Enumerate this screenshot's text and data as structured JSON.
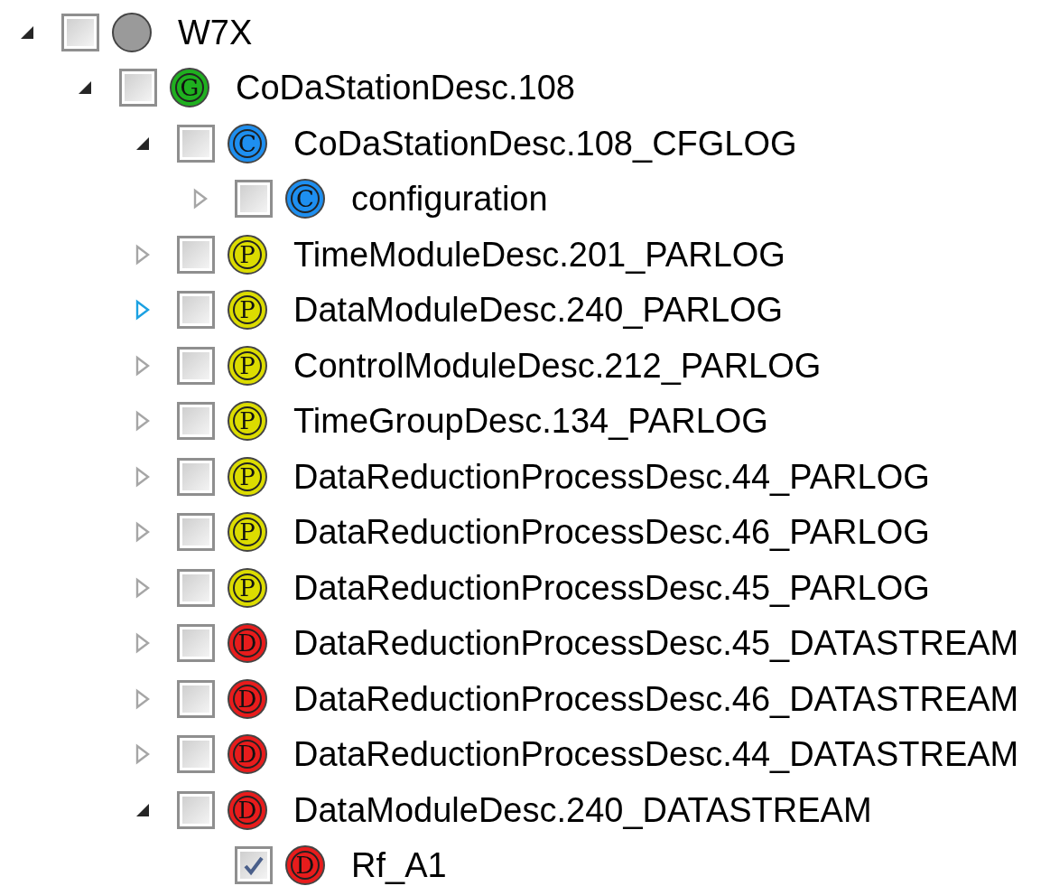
{
  "tree": [
    {
      "label": "W7X",
      "kind": "node",
      "expanded": true,
      "checked": false,
      "hovered": false,
      "color": "#9a9a9a",
      "children": [
        {
          "label": "CoDaStationDesc.108",
          "kind": "node",
          "expanded": true,
          "checked": false,
          "hovered": false,
          "badge": "G",
          "color": "#1fb01f",
          "children": [
            {
              "label": "CoDaStationDesc.108_CFGLOG",
              "kind": "node",
              "expanded": true,
              "checked": false,
              "hovered": false,
              "badge": "C",
              "color": "#1e8ff0",
              "children": [
                {
                  "label": "configuration",
                  "kind": "node",
                  "expanded": false,
                  "checked": false,
                  "hovered": false,
                  "badge": "C",
                  "color": "#1e8ff0"
                }
              ]
            },
            {
              "label": "TimeModuleDesc.201_PARLOG",
              "kind": "node",
              "expanded": false,
              "checked": false,
              "hovered": false,
              "badge": "P",
              "color": "#dcdc00"
            },
            {
              "label": "DataModuleDesc.240_PARLOG",
              "kind": "node",
              "expanded": false,
              "checked": false,
              "hovered": true,
              "badge": "P",
              "color": "#dcdc00"
            },
            {
              "label": "ControlModuleDesc.212_PARLOG",
              "kind": "node",
              "expanded": false,
              "checked": false,
              "hovered": false,
              "badge": "P",
              "color": "#dcdc00"
            },
            {
              "label": "TimeGroupDesc.134_PARLOG",
              "kind": "node",
              "expanded": false,
              "checked": false,
              "hovered": false,
              "badge": "P",
              "color": "#dcdc00"
            },
            {
              "label": "DataReductionProcessDesc.44_PARLOG",
              "kind": "node",
              "expanded": false,
              "checked": false,
              "hovered": false,
              "badge": "P",
              "color": "#dcdc00"
            },
            {
              "label": "DataReductionProcessDesc.46_PARLOG",
              "kind": "node",
              "expanded": false,
              "checked": false,
              "hovered": false,
              "badge": "P",
              "color": "#dcdc00"
            },
            {
              "label": "DataReductionProcessDesc.45_PARLOG",
              "kind": "node",
              "expanded": false,
              "checked": false,
              "hovered": false,
              "badge": "P",
              "color": "#dcdc00"
            },
            {
              "label": "DataReductionProcessDesc.45_DATASTREAM",
              "kind": "node",
              "expanded": false,
              "checked": false,
              "hovered": false,
              "badge": "D",
              "color": "#e81c1c"
            },
            {
              "label": "DataReductionProcessDesc.46_DATASTREAM",
              "kind": "node",
              "expanded": false,
              "checked": false,
              "hovered": false,
              "badge": "D",
              "color": "#e81c1c"
            },
            {
              "label": "DataReductionProcessDesc.44_DATASTREAM",
              "kind": "node",
              "expanded": false,
              "checked": false,
              "hovered": false,
              "badge": "D",
              "color": "#e81c1c"
            },
            {
              "label": "DataModuleDesc.240_DATASTREAM",
              "kind": "node",
              "expanded": true,
              "checked": false,
              "hovered": false,
              "badge": "D",
              "color": "#e81c1c",
              "children": [
                {
                  "label": "Rf_A1",
                  "kind": "leaf",
                  "checked": true,
                  "badge": "D",
                  "color": "#e81c1c"
                }
              ]
            }
          ]
        }
      ]
    }
  ]
}
